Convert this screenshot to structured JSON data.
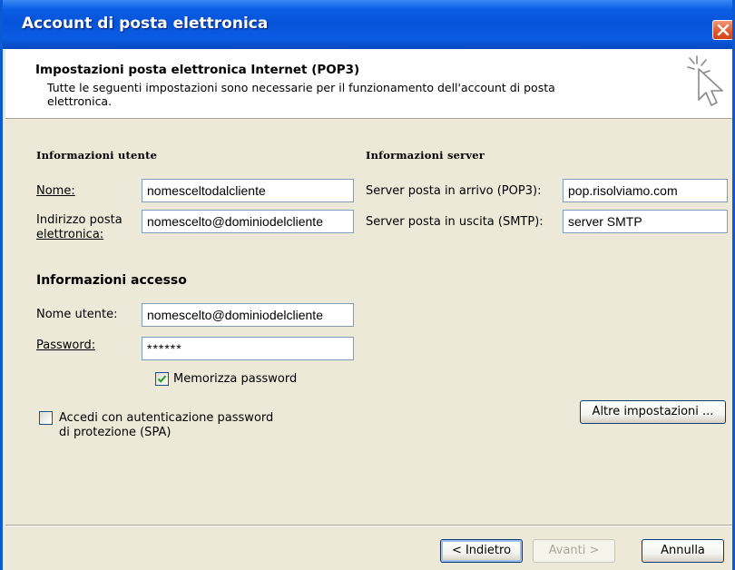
{
  "window": {
    "title": "Account di posta elettronica"
  },
  "header": {
    "title": "Impostazioni posta elettronica Internet (POP3)",
    "subtitle": "Tutte le seguenti impostazioni sono necessarie per il funzionamento dell'account di posta elettronica."
  },
  "user_info": {
    "heading": "Informazioni utente",
    "name_label": "Nome:",
    "name_value": "nomesceltodalcliente",
    "email_label_line1": "Indirizzo posta",
    "email_label_line2": "elettronica:",
    "email_value": "nomescelto@dominiodelcliente"
  },
  "server_info": {
    "heading": "Informazioni server",
    "incoming_label": "Server posta in arrivo (POP3):",
    "incoming_value": "pop.risolviamo.com",
    "outgoing_label": "Server posta in uscita (SMTP):",
    "outgoing_value": "server SMTP"
  },
  "login_info": {
    "heading": "Informazioni accesso",
    "username_label": "Nome utente:",
    "username_value": "nomescelto@dominiodelcliente",
    "password_label": "Password:",
    "password_value": "******",
    "remember_label": "Memorizza password",
    "remember_checked": true
  },
  "spa": {
    "label_line1": "Accedi con autenticazione password",
    "label_line2": "di protezione (SPA)",
    "checked": false
  },
  "buttons": {
    "more_settings": "Altre impostazioni ...",
    "back": "< Indietro",
    "next": "Avanti >",
    "cancel": "Annulla"
  },
  "icons": {
    "close": "close-icon",
    "wizard": "wizard-cursor-icon",
    "check": "check-icon"
  },
  "colors": {
    "titlebar": "#0653d9",
    "close_button": "#e2592d",
    "dialog_background": "#ece9d8",
    "field_border": "#7f9db9"
  }
}
